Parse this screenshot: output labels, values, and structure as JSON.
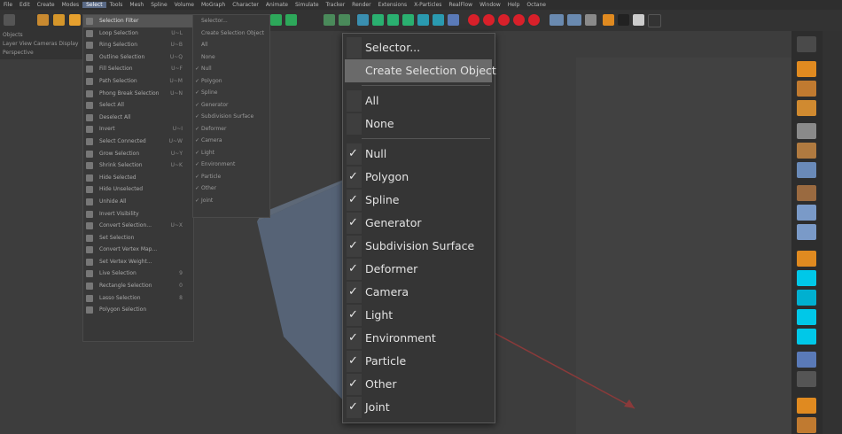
{
  "menubar": {
    "items": [
      "File",
      "Edit",
      "Create",
      "Modes",
      "Select",
      "Tools",
      "Mesh",
      "Spline",
      "Volume",
      "MoGraph",
      "Character",
      "Animate",
      "Simulate",
      "Tracker",
      "Render",
      "Extensions",
      "X-Particles",
      "RealFlow",
      "Window",
      "Help",
      "Octane"
    ],
    "active_index": 4
  },
  "viewport": {
    "head_rows": [
      "Objects",
      "Layer  View  Cameras  Display",
      "Perspective"
    ]
  },
  "select_menu": {
    "title": "Selection Filter",
    "items": [
      {
        "label": "Loop Selection",
        "shortcut": "U~L"
      },
      {
        "label": "Ring Selection",
        "shortcut": "U~B"
      },
      {
        "label": "Outline Selection",
        "shortcut": "U~Q"
      },
      {
        "label": "Fill Selection",
        "shortcut": "U~F"
      },
      {
        "label": "Path Selection",
        "shortcut": "U~M"
      },
      {
        "label": "Phong Break Selection",
        "shortcut": "U~N"
      },
      {
        "label": "Select All",
        "shortcut": ""
      },
      {
        "label": "Deselect All",
        "shortcut": ""
      },
      {
        "label": "Invert",
        "shortcut": "U~I"
      },
      {
        "label": "Select Connected",
        "shortcut": "U~W"
      },
      {
        "label": "Grow Selection",
        "shortcut": "U~Y"
      },
      {
        "label": "Shrink Selection",
        "shortcut": "U~K"
      },
      {
        "label": "Hide Selected",
        "shortcut": ""
      },
      {
        "label": "Hide Unselected",
        "shortcut": ""
      },
      {
        "label": "Unhide All",
        "shortcut": ""
      },
      {
        "label": "Invert Visibility",
        "shortcut": ""
      },
      {
        "label": "Convert Selection...",
        "shortcut": "U~X"
      },
      {
        "label": "Set Selection",
        "shortcut": ""
      },
      {
        "label": "Convert Vertex Map...",
        "shortcut": ""
      },
      {
        "label": "Set Vertex Weight...",
        "shortcut": ""
      },
      {
        "label": "Live Selection",
        "shortcut": "9"
      },
      {
        "label": "Rectangle Selection",
        "shortcut": "0"
      },
      {
        "label": "Lasso Selection",
        "shortcut": "8"
      },
      {
        "label": "Polygon Selection",
        "shortcut": ""
      }
    ]
  },
  "bg_submenu": {
    "items": [
      "Selector...",
      "Create Selection Object",
      "All",
      "None",
      "Null",
      "Polygon",
      "Spline",
      "Generator",
      "Subdivision Surface",
      "Deformer",
      "Camera",
      "Light",
      "Environment",
      "Particle",
      "Other",
      "Joint"
    ]
  },
  "filter_menu": {
    "selector": "Selector...",
    "create_object": "Create Selection Object",
    "all": "All",
    "none": "None",
    "check_glyph": "✓",
    "filters": [
      "Null",
      "Polygon",
      "Spline",
      "Generator",
      "Subdivision Surface",
      "Deformer",
      "Camera",
      "Light",
      "Environment",
      "Particle",
      "Other",
      "Joint"
    ]
  },
  "colors": {
    "menubar_active": "#5a6a86",
    "highlight": "#6a6a6a",
    "red_icons": "#d8202a",
    "cyan_icons": "#00c8e8",
    "orange_icons": "#e08a20"
  },
  "icons": [
    "undo-icon",
    "move-icon",
    "scale-icon",
    "rotate-icon",
    "render-icon",
    "cube-icon",
    "spline-icon",
    "light-icon",
    "camera-icon"
  ]
}
